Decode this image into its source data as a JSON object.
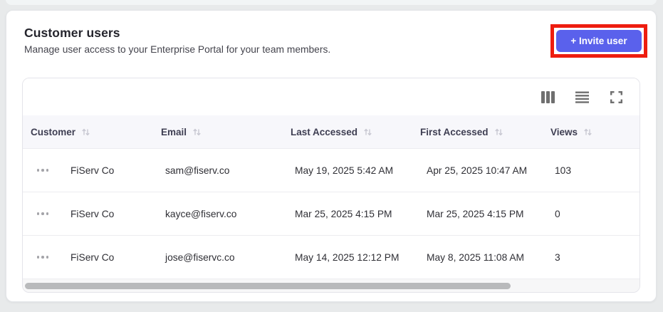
{
  "header": {
    "title": "Customer users",
    "subtitle": "Manage user access to your Enterprise Portal for your team members.",
    "invite_button_label": "+ Invite user"
  },
  "colors": {
    "accent": "#5a61ec",
    "annotation_highlight": "#ee1d0f",
    "header_row_bg": "#f7f7fb",
    "icon_gray": "#6f6f6f"
  },
  "toolbar": {
    "icons": [
      "columns-icon",
      "row-height-icon",
      "fullscreen-icon"
    ]
  },
  "table": {
    "columns": [
      {
        "label": "Customer",
        "sortable": true
      },
      {
        "label": "Email",
        "sortable": true
      },
      {
        "label": "Last Accessed",
        "sortable": true
      },
      {
        "label": "First Accessed",
        "sortable": true
      },
      {
        "label": "Views",
        "sortable": true
      }
    ],
    "rows": [
      {
        "customer": "FiServ Co",
        "email": "sam@fiserv.co",
        "last_accessed": "May 19, 2025 5:42 AM",
        "first_accessed": "Apr 25, 2025 10:47 AM",
        "views": "103"
      },
      {
        "customer": "FiServ Co",
        "email": "kayce@fiserv.co",
        "last_accessed": "Mar 25, 2025 4:15 PM",
        "first_accessed": "Mar 25, 2025 4:15 PM",
        "views": "0"
      },
      {
        "customer": "FiServ Co",
        "email": "jose@fiservc.co",
        "last_accessed": "May 14, 2025 12:12 PM",
        "first_accessed": "May 8, 2025 11:08 AM",
        "views": "3"
      }
    ]
  }
}
